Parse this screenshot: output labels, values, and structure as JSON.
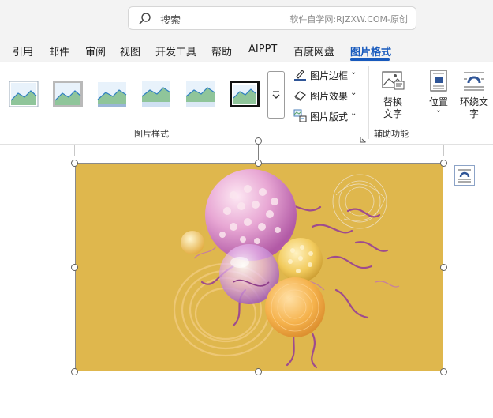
{
  "search": {
    "placeholder": "搜索",
    "watermark": "软件自学网:RJZXW.COM-原创"
  },
  "tabs": [
    {
      "label": "引用"
    },
    {
      "label": "邮件"
    },
    {
      "label": "审阅"
    },
    {
      "label": "视图"
    },
    {
      "label": "开发工具"
    },
    {
      "label": "帮助"
    },
    {
      "label": "AIPPT"
    },
    {
      "label": "百度网盘"
    },
    {
      "label": "图片格式",
      "active": true
    }
  ],
  "ribbon": {
    "picture_styles_label": "图片样式",
    "style_count": 6,
    "format_commands": [
      {
        "label": "图片边框",
        "icon": "pen-border-icon"
      },
      {
        "label": "图片效果",
        "icon": "effects-icon"
      },
      {
        "label": "图片版式",
        "icon": "layout-picture-icon"
      }
    ],
    "accessibility": {
      "alt_text_line1": "替换",
      "alt_text_line2": "文字",
      "group_label": "辅助功能"
    },
    "arrange": {
      "position_label": "位置",
      "wrap_line1": "环绕文",
      "wrap_line2": "字"
    }
  },
  "colors": {
    "accent": "#185abd",
    "image_bg": "#dfb74d"
  }
}
